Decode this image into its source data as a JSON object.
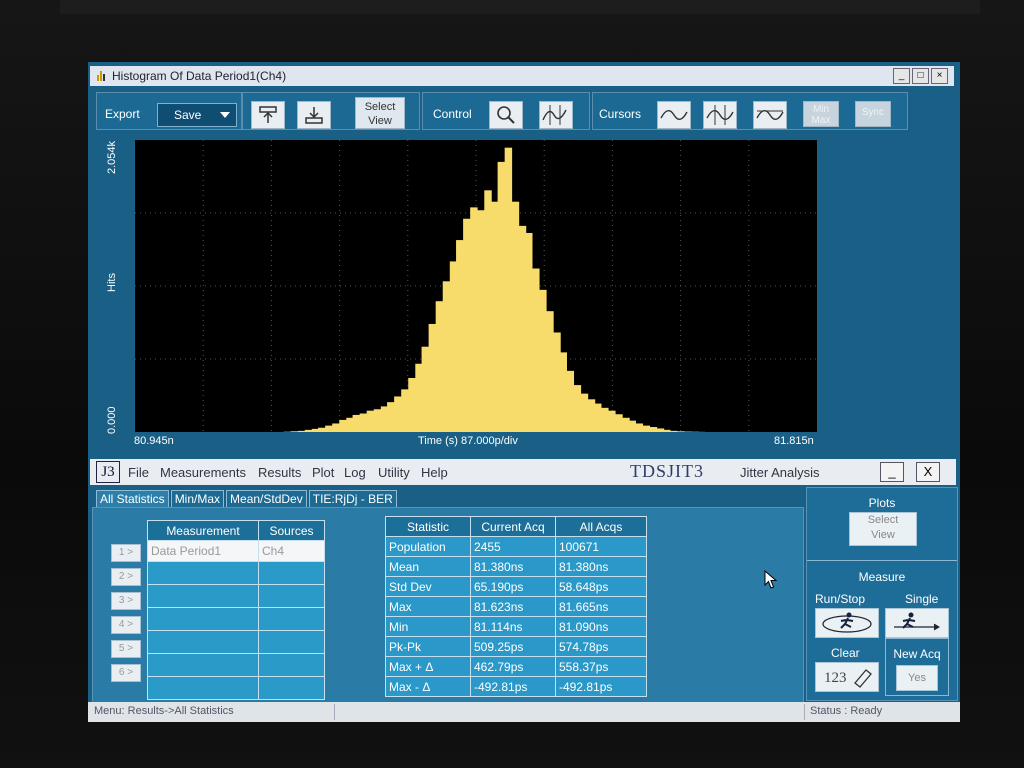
{
  "colors": {
    "accent": "#1a5f86",
    "histogram": "#f7dc6b",
    "plot_bg": "#000000"
  },
  "hist_window": {
    "title": "Histogram Of Data Period1(Ch4)",
    "toolbar": {
      "export_label": "Export",
      "save_value": "Save",
      "select_view_1": "Select",
      "select_view_2": "View",
      "control_label": "Control",
      "cursors_label": "Cursors",
      "minmax_1": "Min",
      "minmax_2": "Max",
      "sync_label": "Sync"
    },
    "axis": {
      "y_label": "Hits",
      "y_max": "2.054k",
      "y_min": "0.000",
      "x_min": "80.945n",
      "x_center": "Time (s)  87.000p/div",
      "x_max": "81.815n"
    }
  },
  "chart_data": {
    "type": "bar",
    "title": "",
    "xlabel": "Time (s)",
    "ylabel": "Hits",
    "xlim": [
      80.945,
      81.815
    ],
    "ylim": [
      0,
      2054
    ],
    "x": [
      80.954,
      80.963,
      80.972,
      80.981,
      80.99,
      80.998,
      81.007,
      81.016,
      81.025,
      81.034,
      81.042,
      81.051,
      81.06,
      81.069,
      81.078,
      81.086,
      81.095,
      81.104,
      81.113,
      81.122,
      81.131,
      81.139,
      81.148,
      81.157,
      81.166,
      81.175,
      81.183,
      81.192,
      81.201,
      81.21,
      81.219,
      81.227,
      81.236,
      81.245,
      81.254,
      81.263,
      81.271,
      81.28,
      81.289,
      81.298,
      81.307,
      81.315,
      81.324,
      81.333,
      81.342,
      81.351,
      81.359,
      81.368,
      81.377,
      81.386,
      81.395,
      81.403,
      81.412,
      81.421,
      81.43,
      81.439,
      81.447,
      81.456,
      81.465,
      81.474,
      81.483,
      81.491,
      81.5,
      81.509,
      81.518,
      81.527,
      81.535,
      81.544,
      81.553,
      81.562,
      81.571,
      81.579,
      81.588,
      81.597,
      81.606,
      81.615,
      81.623,
      81.632,
      81.641,
      81.65,
      81.659,
      81.667,
      81.676,
      81.685,
      81.694,
      81.703,
      81.711,
      81.72,
      81.729,
      81.738,
      81.747,
      81.755,
      81.764,
      81.773,
      81.782,
      81.791,
      81.799,
      81.808
    ],
    "values": [
      0,
      0,
      0,
      0,
      0,
      0,
      0,
      0,
      0,
      0,
      0,
      0,
      0,
      0,
      0,
      0,
      0,
      0,
      0,
      0,
      0,
      2,
      5,
      8,
      15,
      22,
      30,
      45,
      60,
      85,
      100,
      120,
      130,
      150,
      160,
      180,
      210,
      250,
      300,
      380,
      480,
      600,
      760,
      920,
      1060,
      1200,
      1350,
      1500,
      1580,
      1560,
      1700,
      1620,
      1900,
      2000,
      1620,
      1450,
      1400,
      1150,
      1000,
      850,
      700,
      560,
      430,
      330,
      270,
      230,
      200,
      170,
      150,
      125,
      100,
      80,
      60,
      45,
      35,
      25,
      15,
      8,
      5,
      3,
      2,
      1,
      0,
      0,
      0,
      0,
      0,
      0,
      0,
      0,
      0,
      0,
      0,
      0,
      0,
      0,
      0,
      0
    ]
  },
  "app": {
    "logo": "J3",
    "menu": [
      "File",
      "Measurements",
      "Results",
      "Plot",
      "Log",
      "Utility",
      "Help"
    ],
    "brand": "TDSJIT3",
    "brand_sub": "Jitter Analysis",
    "min_label": "_",
    "close_label": "X"
  },
  "tabs": [
    "All Statistics",
    "Min/Max",
    "Mean/StdDev",
    "TIE:RjDj - BER"
  ],
  "row_buttons": [
    "1 >",
    "2 >",
    "3 >",
    "4 >",
    "5 >",
    "6 >"
  ],
  "meas_table": {
    "headers": [
      "Measurement",
      "Sources"
    ],
    "rows": [
      [
        "Data Period1",
        "Ch4"
      ],
      [
        "",
        ""
      ],
      [
        "",
        ""
      ],
      [
        "",
        ""
      ],
      [
        "",
        ""
      ],
      [
        "",
        ""
      ],
      [
        "",
        ""
      ]
    ]
  },
  "stats_table": {
    "headers": [
      "Statistic",
      "Current Acq",
      "All Acqs"
    ],
    "rows": [
      [
        "Population",
        "2455",
        "100671"
      ],
      [
        "Mean",
        "81.380ns",
        "81.380ns"
      ],
      [
        "Std Dev",
        "65.190ps",
        "58.648ps"
      ],
      [
        "Max",
        "81.623ns",
        "81.665ns"
      ],
      [
        "Min",
        "81.114ns",
        "81.090ns"
      ],
      [
        "Pk-Pk",
        "509.25ps",
        "574.78ps"
      ],
      [
        "Max + Δ",
        "462.79ps",
        "558.37ps"
      ],
      [
        "Max - Δ",
        "-492.81ps",
        "-492.81ps"
      ]
    ]
  },
  "right_panel": {
    "plots_title": "Plots",
    "select_1": "Select",
    "select_2": "View",
    "measure_title": "Measure",
    "run_stop": "Run/Stop",
    "single": "Single",
    "clear": "Clear",
    "clear_icon_text": "123",
    "new_acq": "New Acq",
    "yes": "Yes"
  },
  "status": {
    "menu_path": "Menu: Results->All Statistics",
    "status": "Status : Ready"
  }
}
